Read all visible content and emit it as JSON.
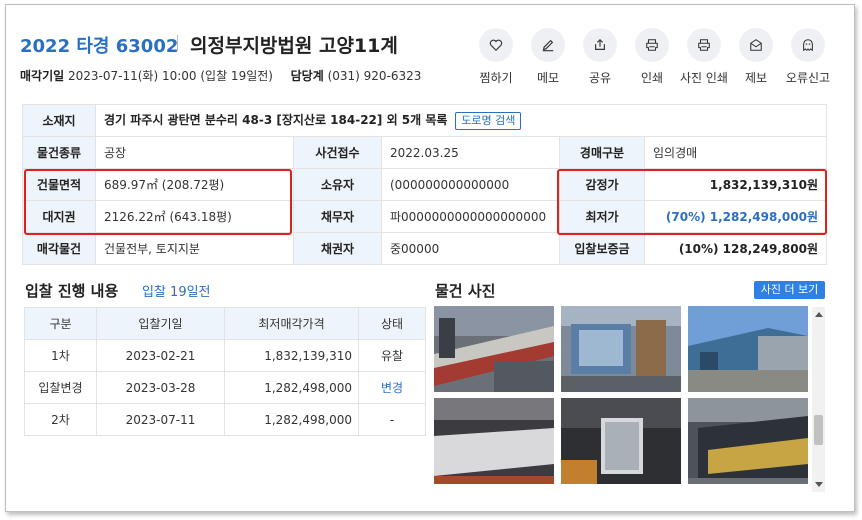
{
  "header": {
    "case_number": "2022 타경 63002",
    "court": "의정부지방법원 고양11계",
    "sale_date_label": "매각기일",
    "sale_date_value": "2023-07-11(화) 10:00 (입찰 19일전)",
    "dept_label": "담당계",
    "dept_phone": "(031) 920-6323"
  },
  "actions": [
    {
      "label": "찜하기",
      "icon": "heart-icon"
    },
    {
      "label": "메모",
      "icon": "edit-icon"
    },
    {
      "label": "공유",
      "icon": "share-icon"
    },
    {
      "label": "인쇄",
      "icon": "print-icon"
    },
    {
      "label": "사진 인쇄",
      "icon": "print-icon"
    },
    {
      "label": "제보",
      "icon": "mail-icon"
    },
    {
      "label": "오류신고",
      "icon": "ghost-icon"
    }
  ],
  "info": {
    "address_label": "소재지",
    "address_value": "경기 파주시 광탄면 분수리 48-3 [장지산로 184-22] 외 5개 목록",
    "road_button": "도로명 검색",
    "type_label": "물건종류",
    "type_value": "공장",
    "received_label": "사건접수",
    "received_value": "2022.03.25",
    "auction_kind_label": "경매구분",
    "auction_kind_value": "임의경매",
    "building_area_label": "건물면적",
    "building_area_value": "689.97㎡ (208.72평)",
    "owner_label": "소유자",
    "owner_value": "(000000000000000",
    "appraisal_label": "감정가",
    "appraisal_value": "1,832,139,310원",
    "land_right_label": "대지권",
    "land_right_value": "2126.22㎡ (643.18평)",
    "debtor_label": "채무자",
    "debtor_value": "파0000000000000000000",
    "min_price_label": "최저가",
    "min_price_value": "(70%) 1,282,498,000원",
    "sale_item_label": "매각물건",
    "sale_item_value": "건물전부, 토지지분",
    "creditor_label": "채권자",
    "creditor_value": "중00000",
    "deposit_label": "입찰보증금",
    "deposit_value": "(10%) 128,249,800원"
  },
  "bids": {
    "title": "입찰 진행 내용",
    "subtitle": "입찰 19일전",
    "headers": [
      "구분",
      "입찰기일",
      "최저매각가격",
      "상태"
    ],
    "rows": [
      {
        "round": "1차",
        "date": "2023-02-21",
        "price": "1,832,139,310",
        "status": "유찰"
      },
      {
        "round": "입찰변경",
        "date": "2023-03-28",
        "price": "1,282,498,000",
        "status": "변경"
      },
      {
        "round": "2차",
        "date": "2023-07-11",
        "price": "1,282,498,000",
        "status": "-"
      }
    ]
  },
  "photos": {
    "title": "물건 사진",
    "more_button": "사진 더 보기"
  },
  "colors": {
    "accent": "#2a6fc4",
    "highlight": "#e0201b",
    "header_bg": "#eef4fb"
  }
}
